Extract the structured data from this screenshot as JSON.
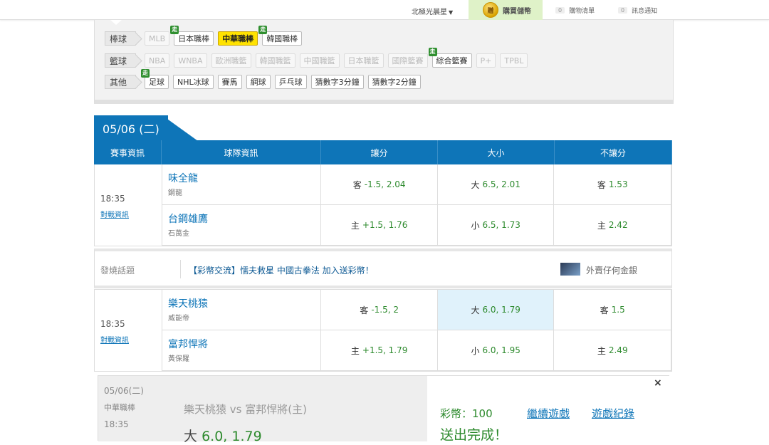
{
  "topbar": {
    "user": "北極光晨星",
    "buy_coin_icon": "贈",
    "buy_label": "購買儲幣",
    "cart_count": "0",
    "cart_label": "購物清單",
    "notice_count": "0",
    "notice_label": "訊息通知"
  },
  "categories": {
    "baseball": {
      "label": "棒球",
      "chips": [
        "MLB",
        "日本職棒",
        "中華職棒",
        "韓國職棒"
      ]
    },
    "basketball": {
      "label": "籃球",
      "chips": [
        "NBA",
        "WNBA",
        "歐洲職籃",
        "韓國職籃",
        "中國職籃",
        "日本職籃",
        "國際籃賽",
        "綜合籃賽",
        "P+",
        "TPBL"
      ]
    },
    "other": {
      "label": "其他",
      "chips": [
        "足球",
        "NHL冰球",
        "賽馬",
        "網球",
        "乒乓球",
        "猜數字3分鐘",
        "猜數字2分鐘"
      ]
    },
    "go_badge": "走"
  },
  "date_tab": "05/06 (二)",
  "table": {
    "headers": [
      "賽事資訊",
      "球隊資訊",
      "讓分",
      "大小",
      "不讓分"
    ],
    "games": [
      {
        "time": "18:35",
        "link": "對戰資訊",
        "rows": [
          {
            "team": "味全龍",
            "pitcher": "鋼龍",
            "spread_side": "客",
            "spread": "-1.5, 2.04",
            "total_side": "大",
            "total": "6.5, 2.01",
            "ml_side": "客",
            "ml": "1.53"
          },
          {
            "team": "台鋼雄鷹",
            "pitcher": "石萬金",
            "spread_side": "主",
            "spread": "+1.5, 1.76",
            "total_side": "小",
            "total": "6.5, 1.73",
            "ml_side": "主",
            "ml": "2.42"
          }
        ]
      },
      {
        "time": "18:35",
        "link": "對戰資訊",
        "rows": [
          {
            "team": "樂天桃猿",
            "pitcher": "威能帝",
            "spread_side": "客",
            "spread": "-1.5, 2",
            "total_side": "大",
            "total": "6.0, 1.79",
            "ml_side": "客",
            "ml": "1.5"
          },
          {
            "team": "富邦悍將",
            "pitcher": "黃保羅",
            "spread_side": "主",
            "spread": "+1.5, 1.79",
            "total_side": "小",
            "total": "6.0, 1.95",
            "ml_side": "主",
            "ml": "2.49"
          }
        ]
      }
    ]
  },
  "topic": {
    "label": "發燒話題",
    "message": "【彩幣交流】懦夫救星 中國古拳法 加入送彩幣！",
    "author": "外賣仔何金銀"
  },
  "popup": {
    "date": "05/06(二)",
    "league": "中華職棒",
    "time": "18:35",
    "match": "樂天桃猿  vs  富邦悍將(主)",
    "bet_side": "大",
    "bet_value": "6.0, 1.79",
    "coins": "彩幣：100",
    "continue": "繼續遊戲",
    "record": "遊戲紀錄",
    "done": "送出完成！",
    "close": "×"
  }
}
